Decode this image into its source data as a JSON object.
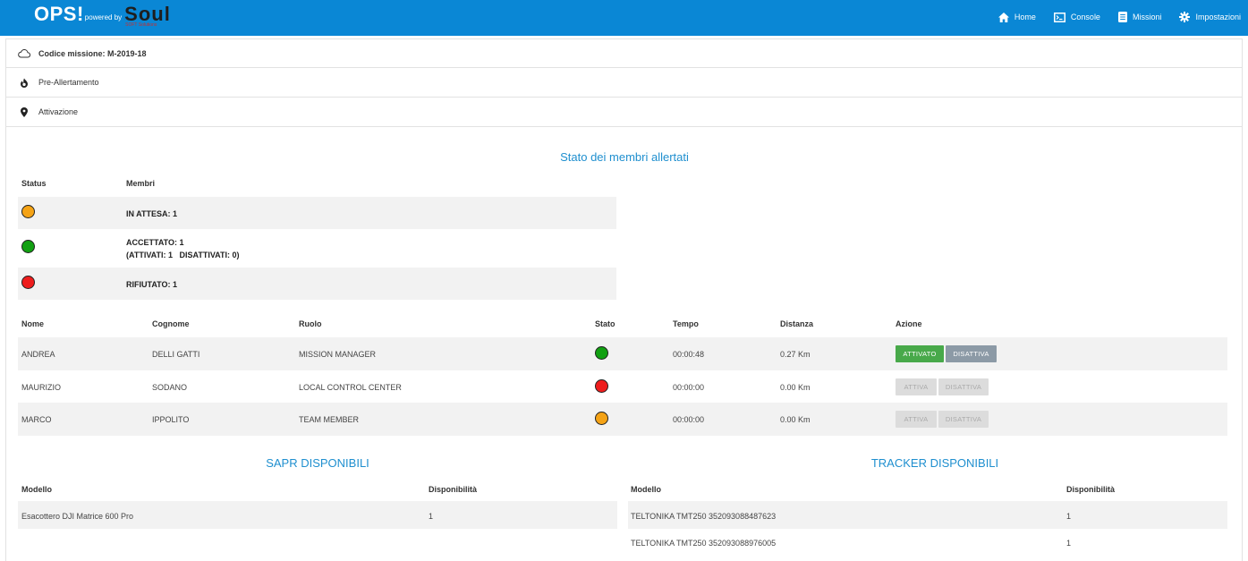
{
  "brand": {
    "ops": "OPS!",
    "powered_by": "powered by",
    "soul": "Soul",
    "soul_sub": "SOFT Solutions"
  },
  "nav": [
    {
      "label": "Home",
      "icon": "home-icon"
    },
    {
      "label": "Console",
      "icon": "console-icon"
    },
    {
      "label": "Missioni",
      "icon": "document-icon"
    },
    {
      "label": "Impostazioni",
      "icon": "gear-icon"
    }
  ],
  "sections": {
    "mission_code": "Codice missione: M-2019-18",
    "pre_alert": "Pre-Allertamento",
    "activation": "Attivazione"
  },
  "members_status": {
    "title": "Stato dei membri allertati",
    "headers": {
      "status": "Status",
      "members": "Membri"
    },
    "rows": [
      {
        "color": "#f5a316",
        "line1": "IN ATTESA: 1",
        "line2": ""
      },
      {
        "color": "#12a012",
        "line1": "ACCETTATO: 1",
        "line2": "(ATTIVATI: 1   DISATTIVATI: 0)"
      },
      {
        "color": "#ee1d1d",
        "line1": "RIFIUTATO: 1",
        "line2": ""
      }
    ]
  },
  "members_table": {
    "headers": {
      "nome": "Nome",
      "cognome": "Cognome",
      "ruolo": "Ruolo",
      "stato": "Stato",
      "tempo": "Tempo",
      "distanza": "Distanza",
      "azione": "Azione"
    },
    "rows": [
      {
        "nome": "ANDREA",
        "cognome": "DELLI GATTI",
        "ruolo": "MISSION MANAGER",
        "stato_color": "#12a012",
        "tempo": "00:00:48",
        "distanza": "0.27 Km",
        "btn1": "ATTIVATO",
        "btn2": "DISATTIVA",
        "active": true
      },
      {
        "nome": "MAURIZIO",
        "cognome": "SODANO",
        "ruolo": "LOCAL CONTROL CENTER",
        "stato_color": "#ee1d1d",
        "tempo": "00:00:00",
        "distanza": "0.00 Km",
        "btn1": "ATTIVA",
        "btn2": "DISATTIVA",
        "active": false
      },
      {
        "nome": "MARCO",
        "cognome": "IPPOLITO",
        "ruolo": "TEAM MEMBER",
        "stato_color": "#f5a316",
        "tempo": "00:00:00",
        "distanza": "0.00 Km",
        "btn1": "ATTIVA",
        "btn2": "DISATTIVA",
        "active": false
      }
    ]
  },
  "sapr": {
    "title": "SAPR DISPONIBILI",
    "headers": {
      "modello": "Modello",
      "disponibilita": "Disponibilità"
    },
    "rows": [
      {
        "modello": "Esacottero DJI Matrice 600 Pro",
        "disponibilita": "1"
      }
    ]
  },
  "tracker": {
    "title": "TRACKER DISPONIBILI",
    "headers": {
      "modello": "Modello",
      "disponibilita": "Disponibilità"
    },
    "rows": [
      {
        "modello": "TELTONIKA TMT250 352093088487623",
        "disponibilita": "1"
      },
      {
        "modello": "TELTONIKA TMT250 352093088976005",
        "disponibilita": "1"
      }
    ]
  }
}
